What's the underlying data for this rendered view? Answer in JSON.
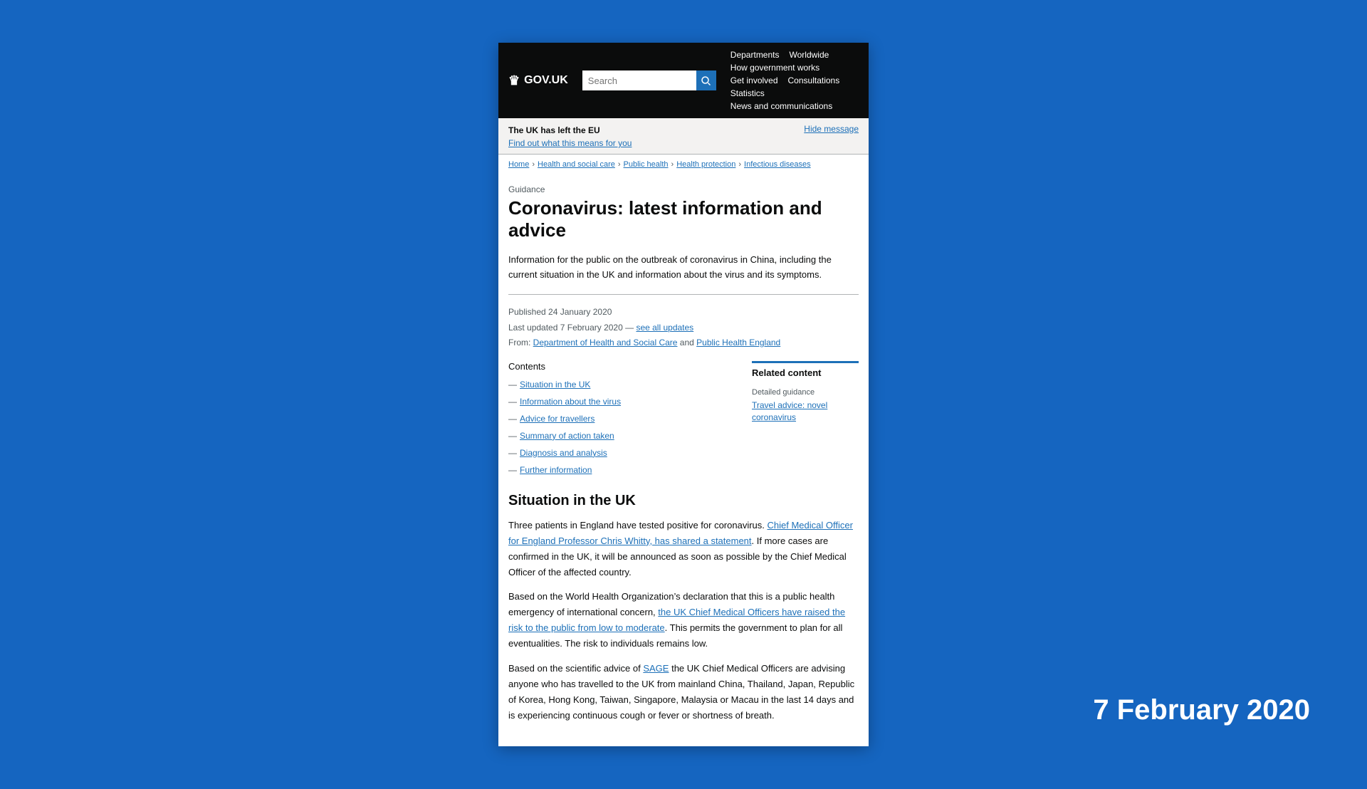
{
  "header": {
    "logo_text": "GOV.UK",
    "search_placeholder": "Search",
    "search_button_label": "Search",
    "nav": {
      "departments": "Departments",
      "worldwide": "Worldwide",
      "how_gov_works": "How government works",
      "get_involved": "Get involved",
      "consultations": "Consultations",
      "statistics": "Statistics",
      "news_comms": "News and communications"
    }
  },
  "brexit_banner": {
    "message": "The UK has left the EU",
    "link_text": "Find out what this means for you",
    "hide_label": "Hide message"
  },
  "breadcrumb": {
    "items": [
      "Home",
      "Health and social care",
      "Public health",
      "Health protection",
      "Infectious diseases"
    ]
  },
  "page": {
    "guidance_label": "Guidance",
    "title": "Coronavirus: latest information and advice",
    "description": "Information for the public on the outbreak of coronavirus in China, including the current situation in the UK and information about the virus and its symptoms.",
    "published": "Published 24 January 2020",
    "last_updated_prefix": "Last updated 7 February 2020 — ",
    "see_all_updates": "see all updates",
    "from_prefix": "From: ",
    "from_org1": "Department of Health and Social Care",
    "from_and": " and ",
    "from_org2": "Public Health England"
  },
  "contents": {
    "title": "Contents",
    "items": [
      {
        "label": "Situation in the UK",
        "anchor": "#situation"
      },
      {
        "label": "Information about the virus",
        "anchor": "#info"
      },
      {
        "label": "Advice for travellers",
        "anchor": "#travellers"
      },
      {
        "label": "Summary of action taken",
        "anchor": "#summary"
      },
      {
        "label": "Diagnosis and analysis",
        "anchor": "#diagnosis"
      },
      {
        "label": "Further information",
        "anchor": "#further"
      }
    ]
  },
  "related": {
    "title": "Related content",
    "detail_label": "Detailed guidance",
    "link_text": "Travel advice: novel coronavirus"
  },
  "sections": {
    "situation": {
      "title": "Situation in the UK",
      "para1_start": "Three patients in England have tested positive for coronavirus. ",
      "para1_link_text": "Chief Medical Officer for England Professor Chris Whitty, has shared a statement",
      "para1_end": ". If more cases are confirmed in the UK, it will be announced as soon as possible by the Chief Medical Officer of the affected country.",
      "para2_start": "Based on the World Health Organization’s declaration that this is a public health emergency of international concern, ",
      "para2_link_text": "the UK Chief Medical Officers have raised the risk to the public from low to moderate",
      "para2_end": ". This permits the government to plan for all eventualities. The risk to individuals remains low.",
      "para3_start": "Based on the scientific advice of ",
      "para3_link_text": "SAGE",
      "para3_end": " the UK Chief Medical Officers are advising anyone who has travelled to the UK from mainland China, Thailand, Japan, Republic of Korea, Hong Kong, Taiwan, Singapore, Malaysia or Macau in the last 14 days and is experiencing continuous cough or fever or shortness of breath."
    }
  },
  "date_overlay": "7 February 2020"
}
